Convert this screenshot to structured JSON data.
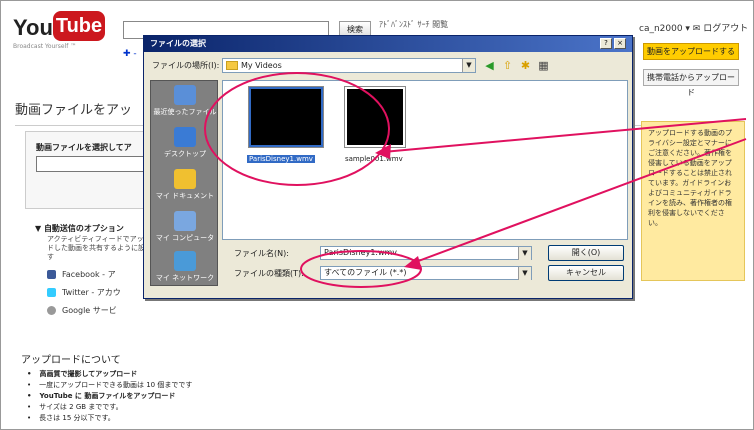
{
  "youtube": {
    "logo_you": "You",
    "logo_tube": "Tube",
    "slogan": "Broadcast Yourself ™",
    "search_button": "検索",
    "search_options": "ｱﾄﾞﾊﾞﾝｽﾄﾞ ｻｰﾁ 閲覧",
    "user_links": "ca_n2000 ▾  ✉  ログアウト",
    "nav_link": "✚ -",
    "page_title": "動画ファイルをアッ",
    "upload_label": "動画ファイルを選択してア",
    "advanced_title": "▼ 自動送信のオプション",
    "advanced_text": "アクティビティフィードでアップロードした動画を共有するように設定します",
    "share_facebook": "Facebook - ア",
    "share_twitter": "Twitter - アカウ",
    "share_google": "Google サービ",
    "upload_button": "動画をアップロードする",
    "mobile_button": "携帯電話からアップロード",
    "tip_text": "アップロードする動画のプライバシー設定とマナーにご注意ください。著作権を侵害している動画をアップロードすることは禁止されています。ガイドラインおよびコミュニティガイドラインを読み、著作権者の権利を侵害しないでください。",
    "about_title": "アップロードについて",
    "about_items": [
      "高画質で撮影してアップロード",
      "一度にアップロードできる動画は 10 個までです",
      "YouTube に 動画ファイルをアップロード",
      "サイズは 2 GB までです。",
      "長さは 15 分以下です。"
    ]
  },
  "dialog": {
    "title": "ファイルの選択",
    "help": "?",
    "close": "×",
    "look_in_label": "ファイルの場所(I):",
    "look_in_value": "My Videos",
    "places": [
      "最近使ったファイル",
      "デスクトップ",
      "マイ ドキュメント",
      "マイ コンピュータ",
      "マイ ネットワーク"
    ],
    "files": [
      {
        "name": "ParisDisney1.wmv",
        "selected": true
      },
      {
        "name": "sample001.wmv",
        "selected": false
      }
    ],
    "filename_label": "ファイル名(N):",
    "filename_value": "ParisDisney1.wmv",
    "filetype_label": "ファイルの種類(T):",
    "filetype_value": "すべてのファイル (*.*)",
    "open_button": "開く(O)",
    "cancel_button": "キャンセル"
  },
  "colors": {
    "annotation": "#e0115f",
    "titlebar": "#0a246a",
    "selection": "#316ac5",
    "tip_bg": "#ffeaa0"
  }
}
